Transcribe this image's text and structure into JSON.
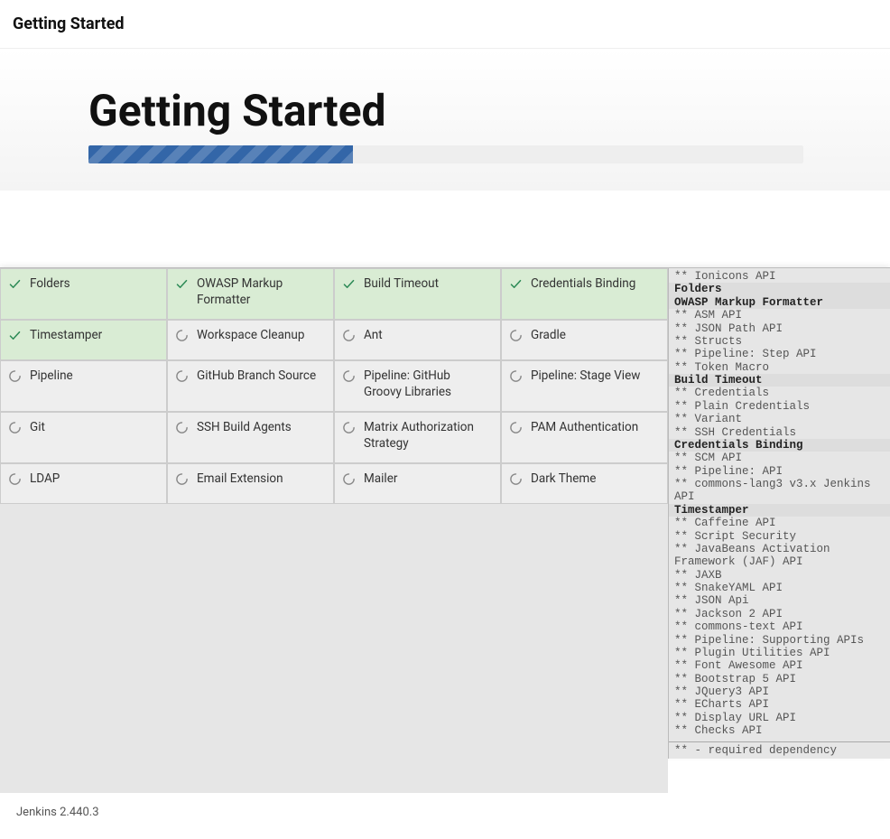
{
  "topbar": {
    "title": "Getting Started"
  },
  "hero": {
    "heading": "Getting Started"
  },
  "grid": {
    "cells": [
      {
        "label": "Folders",
        "state": "done"
      },
      {
        "label": "OWASP Markup Formatter",
        "state": "done"
      },
      {
        "label": "Build Timeout",
        "state": "done"
      },
      {
        "label": "Credentials Binding",
        "state": "done"
      },
      {
        "label": "Timestamper",
        "state": "done"
      },
      {
        "label": "Workspace Cleanup",
        "state": "loading"
      },
      {
        "label": "Ant",
        "state": "loading"
      },
      {
        "label": "Gradle",
        "state": "loading"
      },
      {
        "label": "Pipeline",
        "state": "loading"
      },
      {
        "label": "GitHub Branch Source",
        "state": "loading"
      },
      {
        "label": "Pipeline: GitHub Groovy Libraries",
        "state": "loading"
      },
      {
        "label": "Pipeline: Stage View",
        "state": "loading"
      },
      {
        "label": "Git",
        "state": "loading"
      },
      {
        "label": "SSH Build Agents",
        "state": "loading"
      },
      {
        "label": "Matrix Authorization Strategy",
        "state": "loading"
      },
      {
        "label": "PAM Authentication",
        "state": "loading"
      },
      {
        "label": "LDAP",
        "state": "loading"
      },
      {
        "label": "Email Extension",
        "state": "loading"
      },
      {
        "label": "Mailer",
        "state": "loading"
      },
      {
        "label": "Dark Theme",
        "state": "loading"
      }
    ]
  },
  "log": {
    "preGroups": [
      "** Ionicons API"
    ],
    "groups": [
      {
        "title": "Folders",
        "deps": []
      },
      {
        "title": "OWASP Markup Formatter",
        "deps": [
          "** ASM API",
          "** JSON Path API",
          "** Structs",
          "** Pipeline: Step API",
          "** Token Macro"
        ]
      },
      {
        "title": "Build Timeout",
        "deps": [
          "** Credentials",
          "** Plain Credentials",
          "** Variant",
          "** SSH Credentials"
        ]
      },
      {
        "title": "Credentials Binding",
        "deps": [
          "** SCM API",
          "** Pipeline: API",
          "** commons-lang3 v3.x Jenkins API"
        ]
      },
      {
        "title": "Timestamper",
        "deps": [
          "** Caffeine API",
          "** Script Security",
          "** JavaBeans Activation Framework (JAF) API",
          "** JAXB",
          "** SnakeYAML API",
          "** JSON Api",
          "** Jackson 2 API",
          "** commons-text API",
          "** Pipeline: Supporting APIs",
          "** Plugin Utilities API",
          "** Font Awesome API",
          "** Bootstrap 5 API",
          "** JQuery3 API",
          "** ECharts API",
          "** Display URL API",
          "** Checks API"
        ]
      }
    ],
    "legend": "** - required dependency"
  },
  "footer": {
    "version": "Jenkins 2.440.3"
  }
}
